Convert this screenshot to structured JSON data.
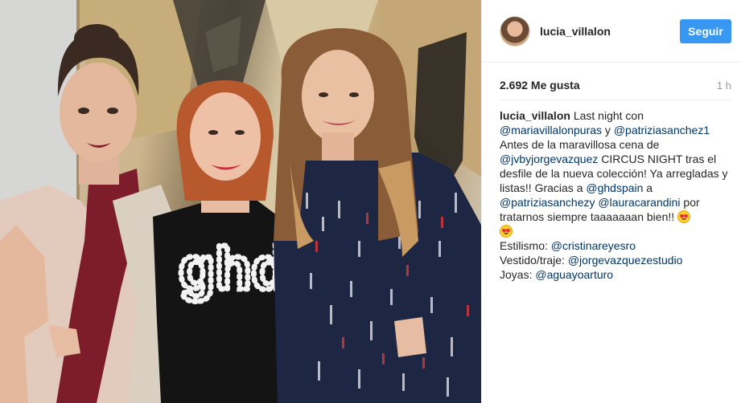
{
  "post": {
    "image_alt": "Three women posing together in front of an abstract painting",
    "shirt_text": "ghd"
  },
  "header": {
    "username": "lucia_villalon",
    "follow_label": "Seguir"
  },
  "stats": {
    "likes": "2.692 Me gusta",
    "time": "1 h"
  },
  "caption": {
    "author": "lucia_villalon",
    "t1": " Last night con ",
    "m1": "@mariavillalonpuras",
    "t2": " y ",
    "m2": "@patriziasanchez1",
    "t3": " Antes de la maravillosa cena de ",
    "m3": "@jvbyjorgevazquez",
    "t4": " CIRCUS NIGHT tras el desfile de la nueva colección! Ya arregladas y listas!! Gracias a ",
    "m4": "@ghdspain",
    "t5": " a ",
    "m5": "@patriziasanchezy",
    "t6": " ",
    "m6": "@lauracarandini",
    "t7": " por tratarnos siempre taaaaaaan bien!! ",
    "styling_label": "Estilismo: ",
    "styling_mention": "@cristinareyesro",
    "dress_label": "Vestido/traje: ",
    "dress_mention": "@jorgevazquezestudio",
    "jewelry_label": "Joyas: ",
    "jewelry_mention": "@aguayoarturo"
  },
  "colors": {
    "follow_button": "#3897f0",
    "mention": "#003569",
    "text": "#262626",
    "muted": "#999999"
  },
  "icons": [
    "heart-eyes-emoji-icon"
  ]
}
